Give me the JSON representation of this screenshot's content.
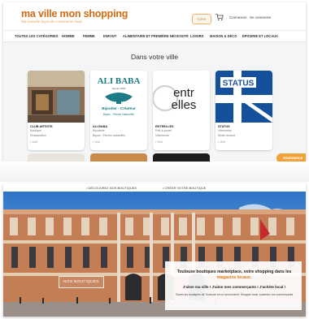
{
  "header": {
    "logo": "ma ville mon shopping",
    "tagline": "Ma nouvelle façon de consommer local",
    "login_label": "Conn",
    "links": [
      "Connexion",
      "Se connecter"
    ]
  },
  "nav": {
    "items": [
      "TOUTES LES CATÉGORIES",
      "HOMME",
      "FEMME",
      "ENFANT",
      "ALIMENTAIRE ET PREMIÈRE NÉCESSITÉ",
      "LOISIRS",
      "MAISON & DÉCO",
      "ÉPICERIE ET LOCAUX"
    ]
  },
  "section": {
    "title": "Dans votre ville"
  },
  "cards": [
    {
      "name": "CLUB ARTISTE",
      "line1": "Boutique",
      "line2": "Restauration",
      "pin": "• Visit"
    },
    {
      "name": "ALI BABA",
      "line1": "Bijouterie",
      "line2": "Bijoux - Pierres naturelles",
      "pin": "• Visit",
      "logo_title": "ALI BABA",
      "logo_sub": "Bijoutier - Créateur",
      "logo_sub2": "Bijoux - Pierres Naturelles",
      "logo_since": "depuis 1994"
    },
    {
      "name": "ENTRELLES",
      "line1": "Prêt-à-porter",
      "line2": "Vêtements",
      "pin": "• Visit",
      "logo_word1": "entr",
      "logo_word2": "elles"
    },
    {
      "name": "STATUS",
      "line1": "Vêtements",
      "line2": "Mode homme",
      "pin": "• Visit",
      "logo_text": "STATUS"
    }
  ],
  "help_button": "Assistance",
  "bottom_bar": {
    "links": [
      "• DÉCOUVREZ NOS BOUTIQUES",
      "• CRÉER VOTRE BOUTIQUE"
    ]
  },
  "hero": {
    "button_label": "NOS BOUTIQUES",
    "info_title": "Toulouse boutiques marketplace, votre shopping dans les",
    "info_title_accent": "magasins locaux.",
    "info_line": "J'aime ma ville ! J'aime mes commerçants ! J'achète local !",
    "info_small": "Toutes les boutiques de Toulouse en un seul endroit. Shoppez local, soutenez vos commerçants"
  },
  "colors": {
    "brand": "#d36a12",
    "accent": "#f0a33a",
    "ali_baba_teal": "#1b7c86",
    "status_blue": "#14509b"
  },
  "icons": [
    "cart-icon"
  ]
}
